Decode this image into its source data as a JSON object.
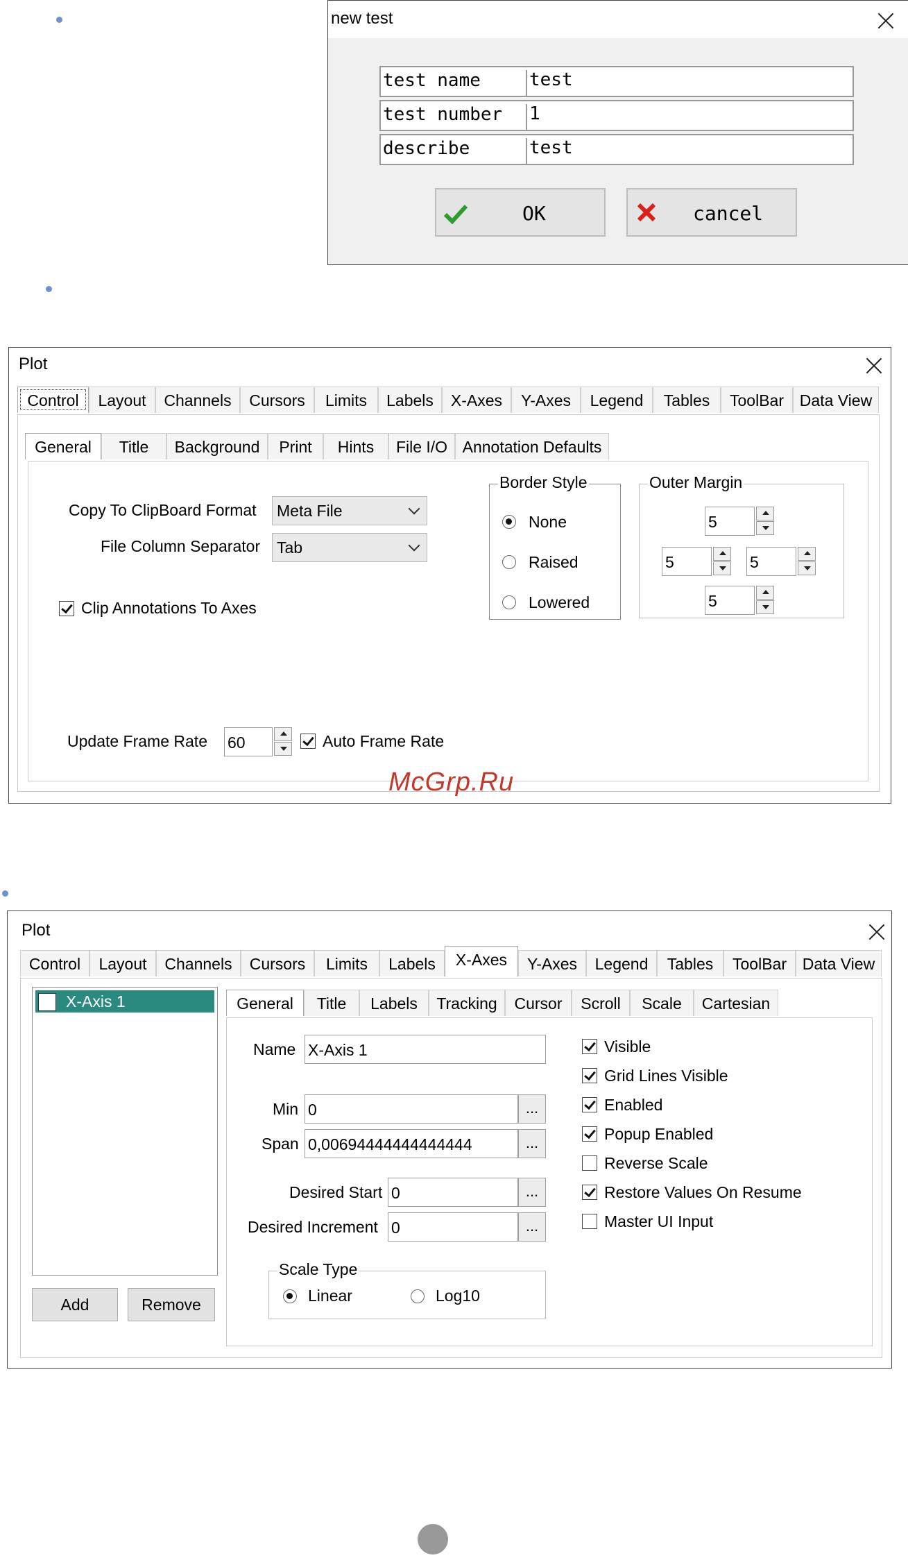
{
  "new_test_dialog": {
    "title": "new test",
    "fields": [
      {
        "label": "test name",
        "value": "test"
      },
      {
        "label": "test number",
        "value": "1"
      },
      {
        "label": "describe",
        "value": "test"
      }
    ],
    "ok_label": "OK",
    "cancel_label": "cancel",
    "ok_icon": "check-icon",
    "cancel_icon": "x-mark-icon",
    "ok_color": "#2e9b2e",
    "cancel_color": "#d9211a"
  },
  "plot_control": {
    "title": "Plot",
    "tabs": [
      "Control",
      "Layout",
      "Channels",
      "Cursors",
      "Limits",
      "Labels",
      "X-Axes",
      "Y-Axes",
      "Legend",
      "Tables",
      "ToolBar",
      "Data View"
    ],
    "active_tab": "Control",
    "subtabs": [
      "General",
      "Title",
      "Background",
      "Print",
      "Hints",
      "File I/O",
      "Annotation Defaults"
    ],
    "active_subtab": "General",
    "clipboard_label": "Copy To ClipBoard Format",
    "clipboard_value": "Meta File",
    "separator_label": "File Column Separator",
    "separator_value": "Tab",
    "clip_annotations_label": "Clip Annotations To Axes",
    "border_style": {
      "label": "Border Style",
      "options": [
        "None",
        "Raised",
        "Lowered"
      ],
      "selected": "None"
    },
    "outer_margin": {
      "label": "Outer Margin",
      "top": "5",
      "left": "5",
      "right": "5",
      "bottom": "5"
    },
    "frame_rate_label": "Update Frame Rate",
    "frame_rate_value": "60",
    "auto_frame_rate_label": "Auto Frame Rate"
  },
  "watermark": "McGrp.Ru",
  "plot_xaxes": {
    "title": "Plot",
    "tabs": [
      "Control",
      "Layout",
      "Channels",
      "Cursors",
      "Limits",
      "Labels",
      "X-Axes",
      "Y-Axes",
      "Legend",
      "Tables",
      "ToolBar",
      "Data View"
    ],
    "active_tab": "X-Axes",
    "axis_list": [
      "X-Axis 1"
    ],
    "add_label": "Add",
    "remove_label": "Remove",
    "subtabs": [
      "General",
      "Title",
      "Labels",
      "Tracking",
      "Cursor",
      "Scroll",
      "Scale",
      "Cartesian"
    ],
    "active_subtab": "General",
    "name_label": "Name",
    "name_value": "X-Axis 1",
    "min_label": "Min",
    "min_value": "0",
    "span_label": "Span",
    "span_value": "0,00694444444444444",
    "desired_start_label": "Desired Start",
    "desired_start_value": "0",
    "desired_increment_label": "Desired Increment",
    "desired_increment_value": "0",
    "dots_label": "...",
    "scale_type": {
      "label": "Scale Type",
      "options": [
        "Linear",
        "Log10"
      ],
      "selected": "Linear"
    },
    "checkboxes": [
      {
        "label": "Visible",
        "checked": true
      },
      {
        "label": "Grid Lines Visible",
        "checked": true
      },
      {
        "label": "Enabled",
        "checked": true
      },
      {
        "label": "Popup Enabled",
        "checked": true
      },
      {
        "label": "Reverse Scale",
        "checked": false
      },
      {
        "label": "Restore Values On Resume",
        "checked": true
      },
      {
        "label": "Master UI Input",
        "checked": false
      }
    ],
    "selection_color": "#2a8a80"
  }
}
